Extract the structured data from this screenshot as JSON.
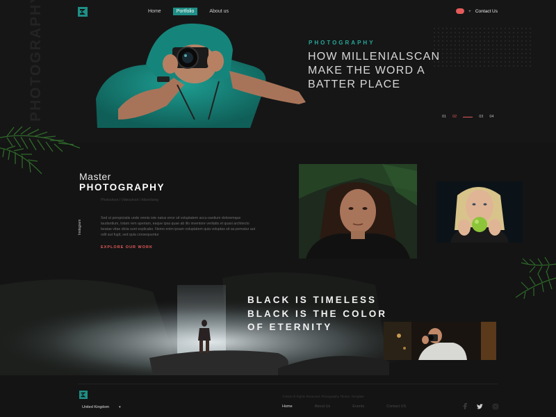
{
  "nav": {
    "items": [
      {
        "label": "Home",
        "active": false
      },
      {
        "label": "Portfolio",
        "active": true
      },
      {
        "label": "About us",
        "active": false
      }
    ],
    "contact_label": "Contact Us"
  },
  "hero": {
    "vertical_label": "PHOTOGRAPHY",
    "kicker": "PHOTOGRAPHY",
    "title_lines": [
      "HOW MILLENIALSCAN",
      "MAKE THE WORD A",
      "BATTER PLACE"
    ],
    "pager": [
      "01",
      "02",
      "03",
      "04"
    ],
    "pager_current": "02"
  },
  "about": {
    "heading_light": "Master",
    "heading_bold": "PHOTOGRAPHY",
    "categories": "Photoshoot / Videoshoot / Advertising",
    "side_label": "Instagram",
    "paragraph": "Sed ut perspiciatis unde omnis iste natus error sit voluptatem accu-santium doloremque laudantium, totam rem aperiam, eaque ipsa quae ab illo inventore veritatis et quasi architecto beatae vitae dicta sunt explicabo. Nemo enim ipsam voluptatem quia voluptas sit as-pernatur aut odit aut fugit, sed quia consequuntur",
    "cta": "EXPLORE OUR WORK"
  },
  "quote": {
    "lines": [
      "BLACK IS TIMELESS",
      "BLACK IS THE COLOR",
      "OF ETERNITY"
    ]
  },
  "footer": {
    "copyright": "©2019 All Rights Reserved. Photography Theme, Template",
    "country": "United Kingdom",
    "nav": [
      {
        "label": "Home",
        "active": true
      },
      {
        "label": "About Us",
        "active": false
      },
      {
        "label": "Events",
        "active": false
      },
      {
        "label": "Contact US",
        "active": false
      }
    ],
    "socials": [
      "facebook-icon",
      "twitter-icon",
      "instagram-icon"
    ]
  },
  "colors": {
    "accent": "#25a89c",
    "highlight": "#e55a5a",
    "background": "#141414"
  }
}
